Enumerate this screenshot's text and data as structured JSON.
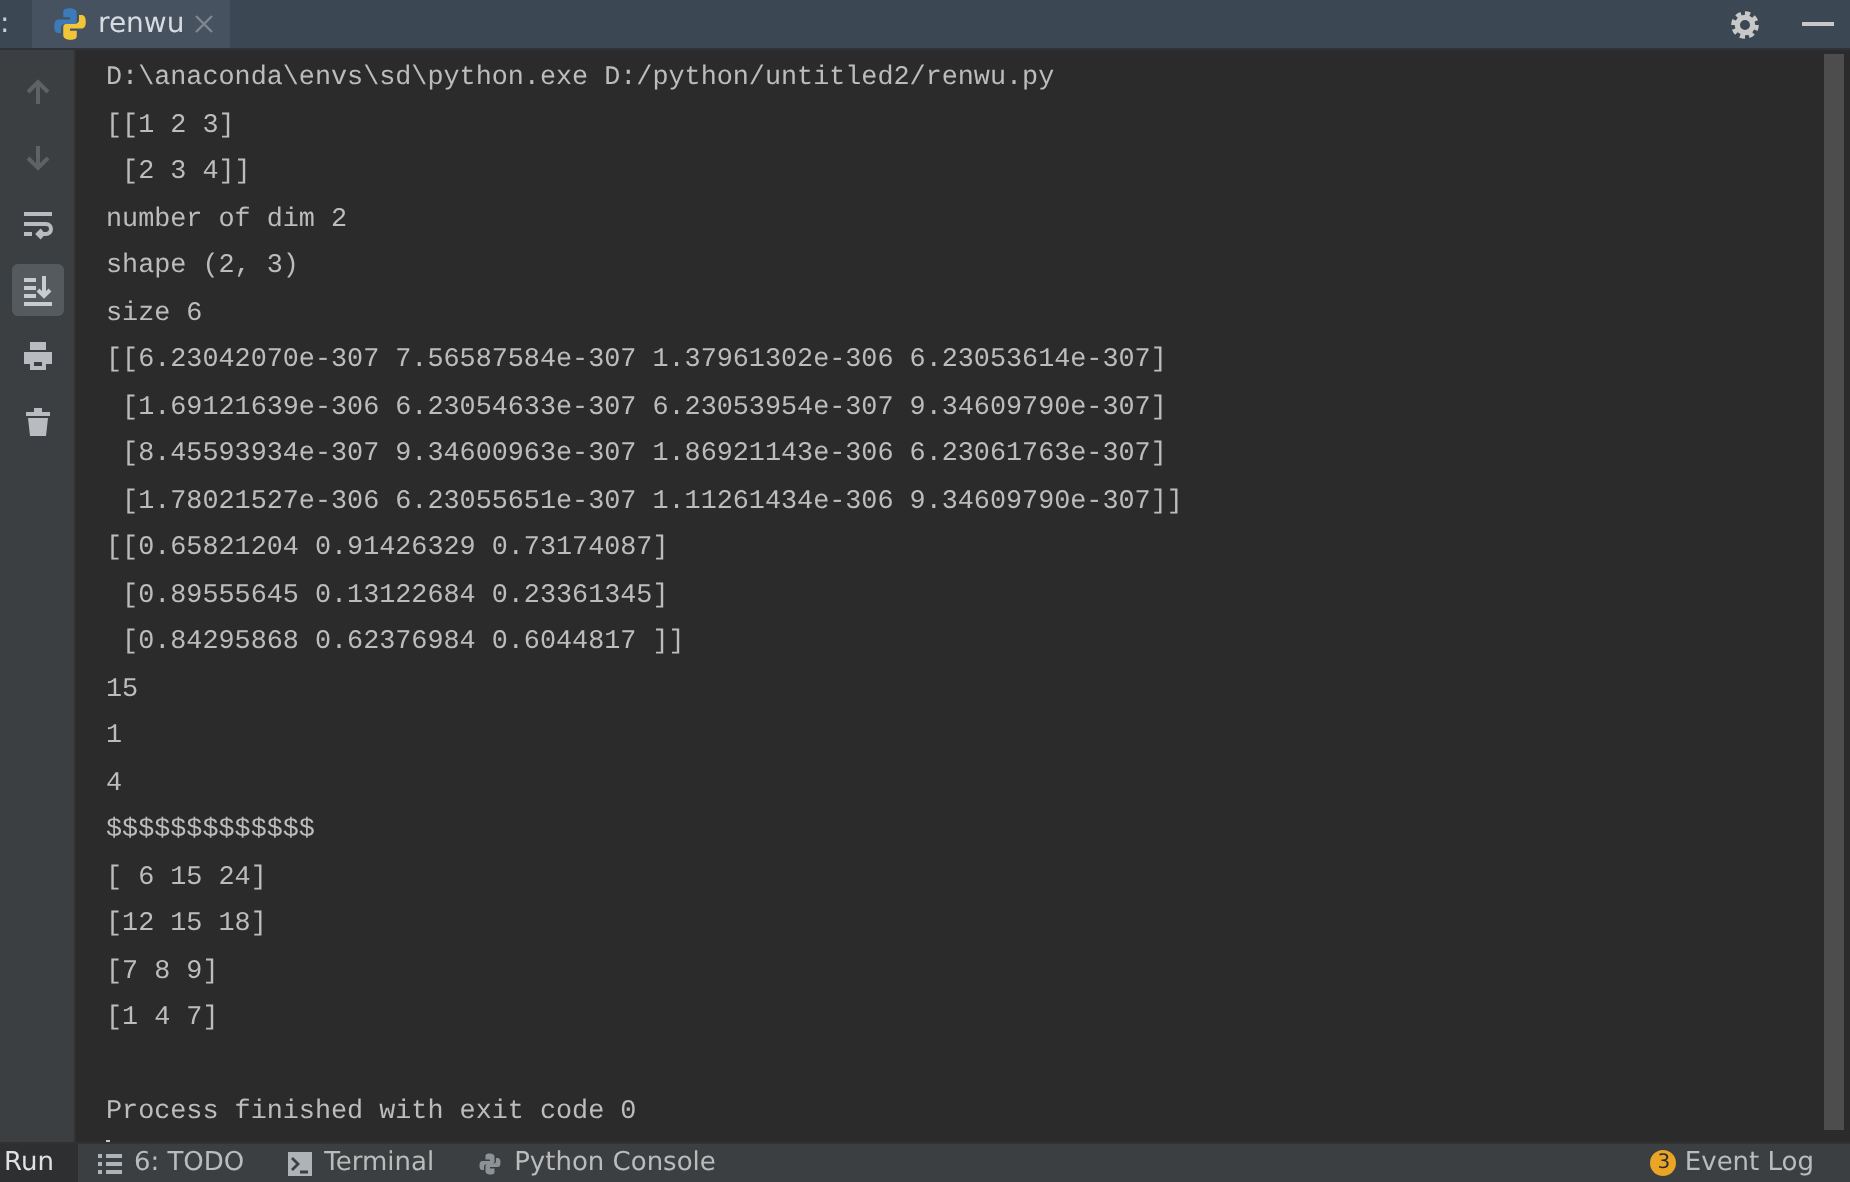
{
  "header": {
    "lead": ":",
    "tabs": [
      {
        "label": "renwu",
        "selected": true
      }
    ]
  },
  "toolbar": [
    {
      "kind": "up",
      "disabled": true,
      "on": false
    },
    {
      "kind": "down",
      "disabled": true,
      "on": false
    },
    {
      "kind": "wrap",
      "disabled": false,
      "on": false
    },
    {
      "kind": "scroll",
      "disabled": false,
      "on": true
    },
    {
      "kind": "print",
      "disabled": false,
      "on": false
    },
    {
      "kind": "trash",
      "disabled": false,
      "on": false
    }
  ],
  "console": {
    "lines": [
      "D:\\anaconda\\envs\\sd\\python.exe D:/python/untitled2/renwu.py",
      "[[1 2 3]",
      " [2 3 4]]",
      "number of dim 2",
      "shape (2, 3)",
      "size 6",
      "[[6.23042070e-307 7.56587584e-307 1.37961302e-306 6.23053614e-307]",
      " [1.69121639e-306 6.23054633e-307 6.23053954e-307 9.34609790e-307]",
      " [8.45593934e-307 9.34600963e-307 1.86921143e-306 6.23061763e-307]",
      " [1.78021527e-306 6.23055651e-307 1.11261434e-306 9.34609790e-307]]",
      "[[0.65821204 0.91426329 0.73174087]",
      " [0.89555645 0.13122684 0.23361345]",
      " [0.84295868 0.62376984 0.6044817 ]]",
      "15",
      "1",
      "4",
      "$$$$$$$$$$$$$",
      "[ 6 15 24]",
      "[12 15 18]",
      "[7 8 9]",
      "[1 4 7]"
    ],
    "status_line": "Process finished with exit code 0"
  },
  "bottom_tabs": [
    {
      "kind": "run",
      "label": "Run",
      "selected": true
    },
    {
      "kind": "todo",
      "label": "6: TODO",
      "selected": false
    },
    {
      "kind": "terminal",
      "label": "Terminal",
      "selected": false
    },
    {
      "kind": "python",
      "label": "Python Console",
      "selected": false
    }
  ],
  "event_log": {
    "badge": "3",
    "label": "Event Log"
  }
}
